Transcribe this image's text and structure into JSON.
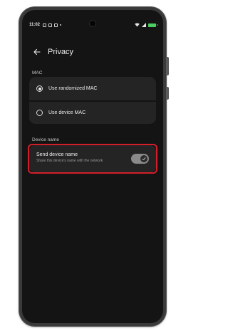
{
  "status_bar": {
    "time": "11:02"
  },
  "app_bar": {
    "title": "Privacy"
  },
  "mac_section": {
    "label": "MAC",
    "options": [
      {
        "label": "Use randomized MAC",
        "selected": true
      },
      {
        "label": "Use device MAC",
        "selected": false
      }
    ]
  },
  "device_name_section": {
    "label": "Device name",
    "setting": {
      "title": "Send device name",
      "subtitle": "Share this device's name with the network",
      "enabled": true
    }
  },
  "colors": {
    "highlight": "#d41e2a",
    "battery": "#4ccf62"
  }
}
